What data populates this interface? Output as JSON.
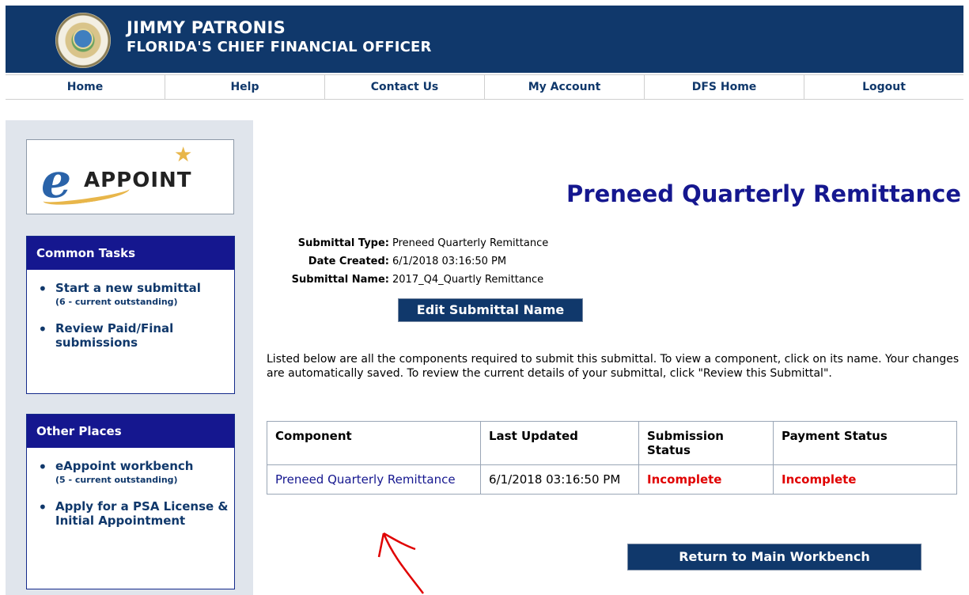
{
  "header": {
    "name": "JIMMY PATRONIS",
    "subtitle": "FLORIDA'S CHIEF FINANCIAL OFFICER"
  },
  "nav": [
    "Home",
    "Help",
    "Contact Us",
    "My Account",
    "DFS Home",
    "Logout"
  ],
  "sidebar": {
    "logo_text": "APPOINT",
    "logo_letter": "e",
    "common_tasks": {
      "title": "Common Tasks",
      "items": [
        {
          "label": "Start a new submittal",
          "note": "(6 - current outstanding)"
        },
        {
          "label": "Review Paid/Final submissions"
        }
      ]
    },
    "other_places": {
      "title": "Other Places",
      "items": [
        {
          "label": "eAppoint workbench",
          "note": "(5 - current outstanding)"
        },
        {
          "label": "Apply for a PSA License & Initial Appointment"
        }
      ]
    }
  },
  "main": {
    "title": "Preneed Quarterly Remittance",
    "meta": [
      {
        "label": "Submittal Type:",
        "value": "Preneed Quarterly Remittance"
      },
      {
        "label": "Date Created:",
        "value": "6/1/2018 03:16:50 PM"
      },
      {
        "label": "Submittal Name:",
        "value": "2017_Q4_Quartly Remittance"
      }
    ],
    "edit_button": "Edit Submittal Name",
    "instructions": "Listed below are all the components required to submit this submittal. To view a component, click on its name. Your changes are automatically saved. To review the current details of your submittal, click \"Review this Submittal\".",
    "table": {
      "headers": [
        "Component",
        "Last Updated",
        "Submission Status",
        "Payment Status"
      ],
      "rows": [
        {
          "component": "Preneed Quarterly Remittance",
          "last_updated": "6/1/2018 03:16:50 PM",
          "submission_status": "Incomplete",
          "payment_status": "Incomplete"
        }
      ]
    },
    "return_button": "Return to Main Workbench"
  },
  "colors": {
    "header_blue": "#10386b",
    "panel_title_blue": "#15178f",
    "sidebar_bg": "#e0e5ec",
    "status_red": "#e00000",
    "annotation_red": "#e00000"
  }
}
